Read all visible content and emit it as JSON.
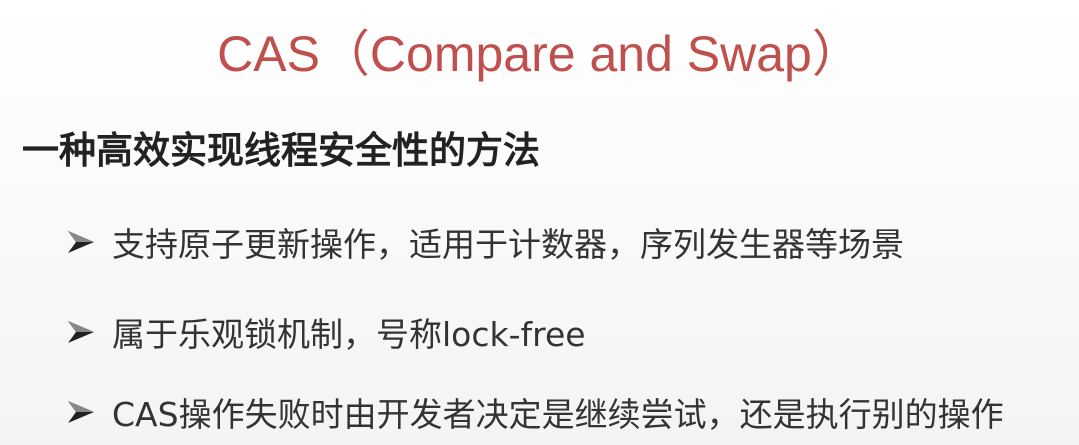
{
  "slide": {
    "title": "CAS（Compare and Swap）",
    "subtitle": "一种高效实现线程安全性的方法",
    "bullets": [
      "支持原子更新操作，适用于计数器，序列发生器等场景",
      "属于乐观锁机制，号称lock-free",
      "CAS操作失败时由开发者决定是继续尝试，还是执行别的操作"
    ],
    "colors": {
      "title": "#c0504d",
      "text": "#333333"
    },
    "bullet_icon": "arrowhead-bullet-icon"
  }
}
